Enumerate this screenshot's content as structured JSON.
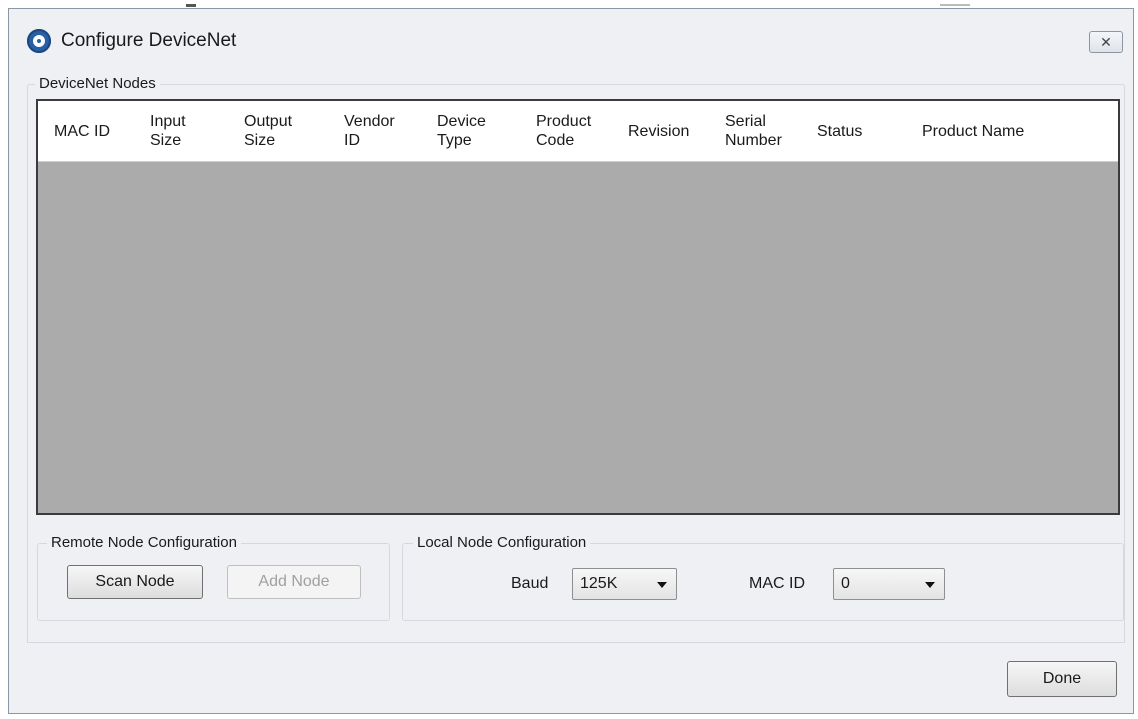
{
  "window": {
    "title": "Configure DeviceNet",
    "close_glyph": "✕",
    "icon": "app-logo-icon"
  },
  "nodes_group": {
    "label": "DeviceNet Nodes",
    "columns": [
      "MAC ID",
      "Input\nSize",
      "Output\nSize",
      "Vendor\nID",
      "Device\nType",
      "Product\nCode",
      "Revision",
      "Serial\nNumber",
      "Status",
      "Product Name"
    ],
    "rows": []
  },
  "remote_group": {
    "label": "Remote Node Configuration",
    "scan_label": "Scan Node",
    "add_label": "Add Node"
  },
  "local_group": {
    "label": "Local Node Configuration",
    "baud_label": "Baud",
    "baud_value": "125K",
    "mac_label": "MAC ID",
    "mac_value": "0"
  },
  "footer": {
    "done_label": "Done"
  }
}
